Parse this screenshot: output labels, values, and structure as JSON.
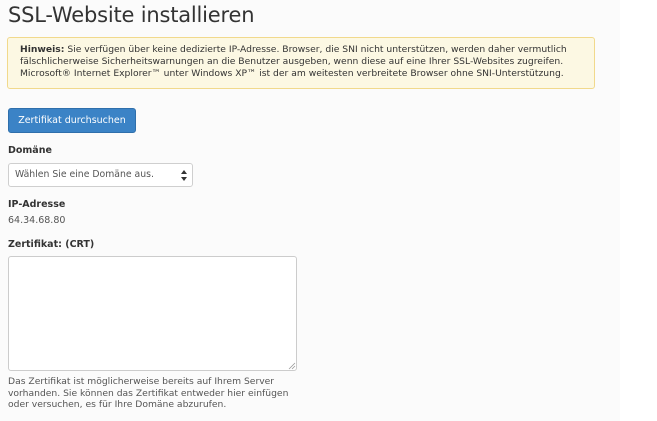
{
  "page": {
    "title": "SSL-Website installieren"
  },
  "notice": {
    "label": "Hinweis:",
    "text": "Sie verfügen über keine dedizierte IP-Adresse. Browser, die SNI nicht unterstützen, werden daher vermutlich fälschlicherweise Sicherheitswarnungen an die Benutzer ausgeben, wenn diese auf eine Ihrer SSL-Websites zugreifen. Microsoft® Internet Explorer™ unter Windows XP™ ist der am weitesten verbreitete Browser ohne SNI-Unterstützung."
  },
  "actions": {
    "browse_label": "Zertifikat durchsuchen"
  },
  "domain": {
    "label": "Domäne",
    "selected": "Wählen Sie eine Domäne aus.",
    "icon": "select-arrows-icon"
  },
  "ip": {
    "label": "IP-Adresse",
    "value": "64.34.68.80"
  },
  "certificate": {
    "label": "Zertifikat: (CRT)",
    "value": "",
    "help": "Das Zertifikat ist möglicherweise bereits auf Ihrem Server vorhanden. Sie können das Zertifikat entweder hier einfügen oder versuchen, es für Ihre Domäne abzurufen."
  },
  "colors": {
    "primary_button": "#3b83c6",
    "notice_background": "#fcf8e3",
    "notice_border": "#f1d98c",
    "text": "#333333"
  }
}
